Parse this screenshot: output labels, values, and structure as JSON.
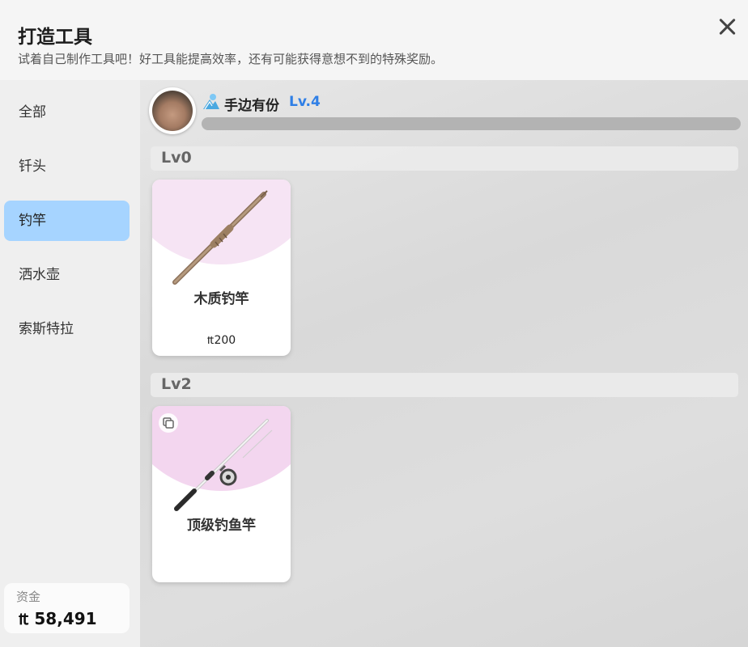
{
  "header": {
    "title": "打造工具",
    "subtitle": "试着自己制作工具吧！好工具能提高效率，还有可能获得意想不到的特殊奖励。"
  },
  "sidebar": {
    "items": [
      {
        "label": "全部",
        "active": false
      },
      {
        "label": "钎头",
        "active": false
      },
      {
        "label": "钓竿",
        "active": true
      },
      {
        "label": "洒水壶",
        "active": false
      },
      {
        "label": "索斯特拉",
        "active": false
      }
    ],
    "funds": {
      "label": "资金",
      "value": "₶ 58,491"
    }
  },
  "profile": {
    "name": "手边有份",
    "level": "Lv.4",
    "xp_fraction": 0
  },
  "sections": [
    {
      "level_label": "Lv0",
      "items": [
        {
          "name": "木质钓竿",
          "price": "₶200",
          "icon": "wooden-fishing-rod"
        }
      ]
    },
    {
      "level_label": "Lv2",
      "items": [
        {
          "name": "顶级钓鱼竿",
          "price": "",
          "icon": "premium-fishing-rod"
        }
      ]
    }
  ],
  "colors": {
    "active_nav": "#a6d4ff",
    "level_text": "#2f7fe6",
    "card_bg_0": "#f6e4f4",
    "card_bg_1": "#f3d6ef"
  }
}
